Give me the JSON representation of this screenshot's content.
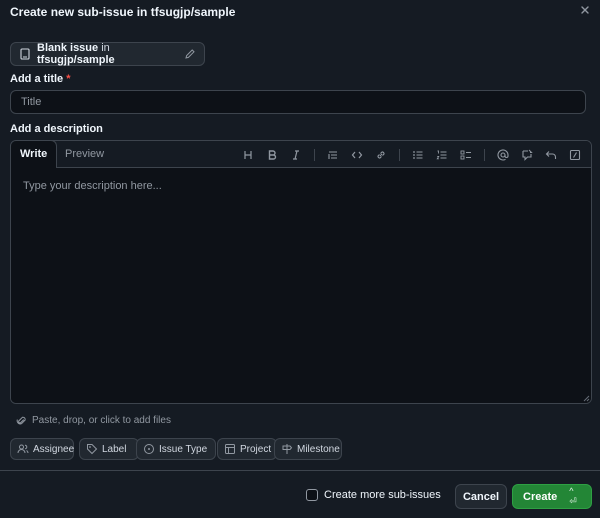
{
  "dialog": {
    "title": "Create new sub-issue in tfsugjp/sample",
    "close_icon": "x-icon"
  },
  "template": {
    "name": "Blank issue",
    "in_text": "in",
    "repo": "tfsugjp/sample"
  },
  "title_field": {
    "label": "Add a title",
    "required_marker": "*",
    "placeholder": "Title",
    "value": ""
  },
  "description": {
    "label": "Add a description",
    "tabs": [
      {
        "label": "Write",
        "active": true
      },
      {
        "label": "Preview",
        "active": false
      }
    ],
    "toolbar": [
      "heading-icon",
      "bold-icon",
      "italic-icon",
      "quote-icon",
      "code-icon",
      "link-icon",
      "bulleted-list-icon",
      "numbered-list-icon",
      "task-list-icon",
      "mention-icon",
      "reference-icon",
      "undo-icon",
      "slash-commands-icon"
    ],
    "placeholder": "Type your description here...",
    "value": ""
  },
  "attach": {
    "text": "Paste, drop, or click to add files"
  },
  "metadata_buttons": [
    {
      "label": "Assignee",
      "icon": "people-icon"
    },
    {
      "label": "Label",
      "icon": "tag-icon"
    },
    {
      "label": "Issue Type",
      "icon": "issue-type-icon"
    },
    {
      "label": "Project",
      "icon": "table-icon"
    },
    {
      "label": "Milestone",
      "icon": "milestone-icon"
    }
  ],
  "footer": {
    "create_more_label": "Create more sub-issues",
    "create_more_checked": false,
    "cancel_label": "Cancel",
    "create_label": "Create",
    "create_shortcut": "^ ⏎"
  },
  "colors": {
    "background": "#151b23",
    "input_bg": "#0d1117",
    "border": "#3d444d",
    "primary": "#238636",
    "required": "#f85149"
  }
}
